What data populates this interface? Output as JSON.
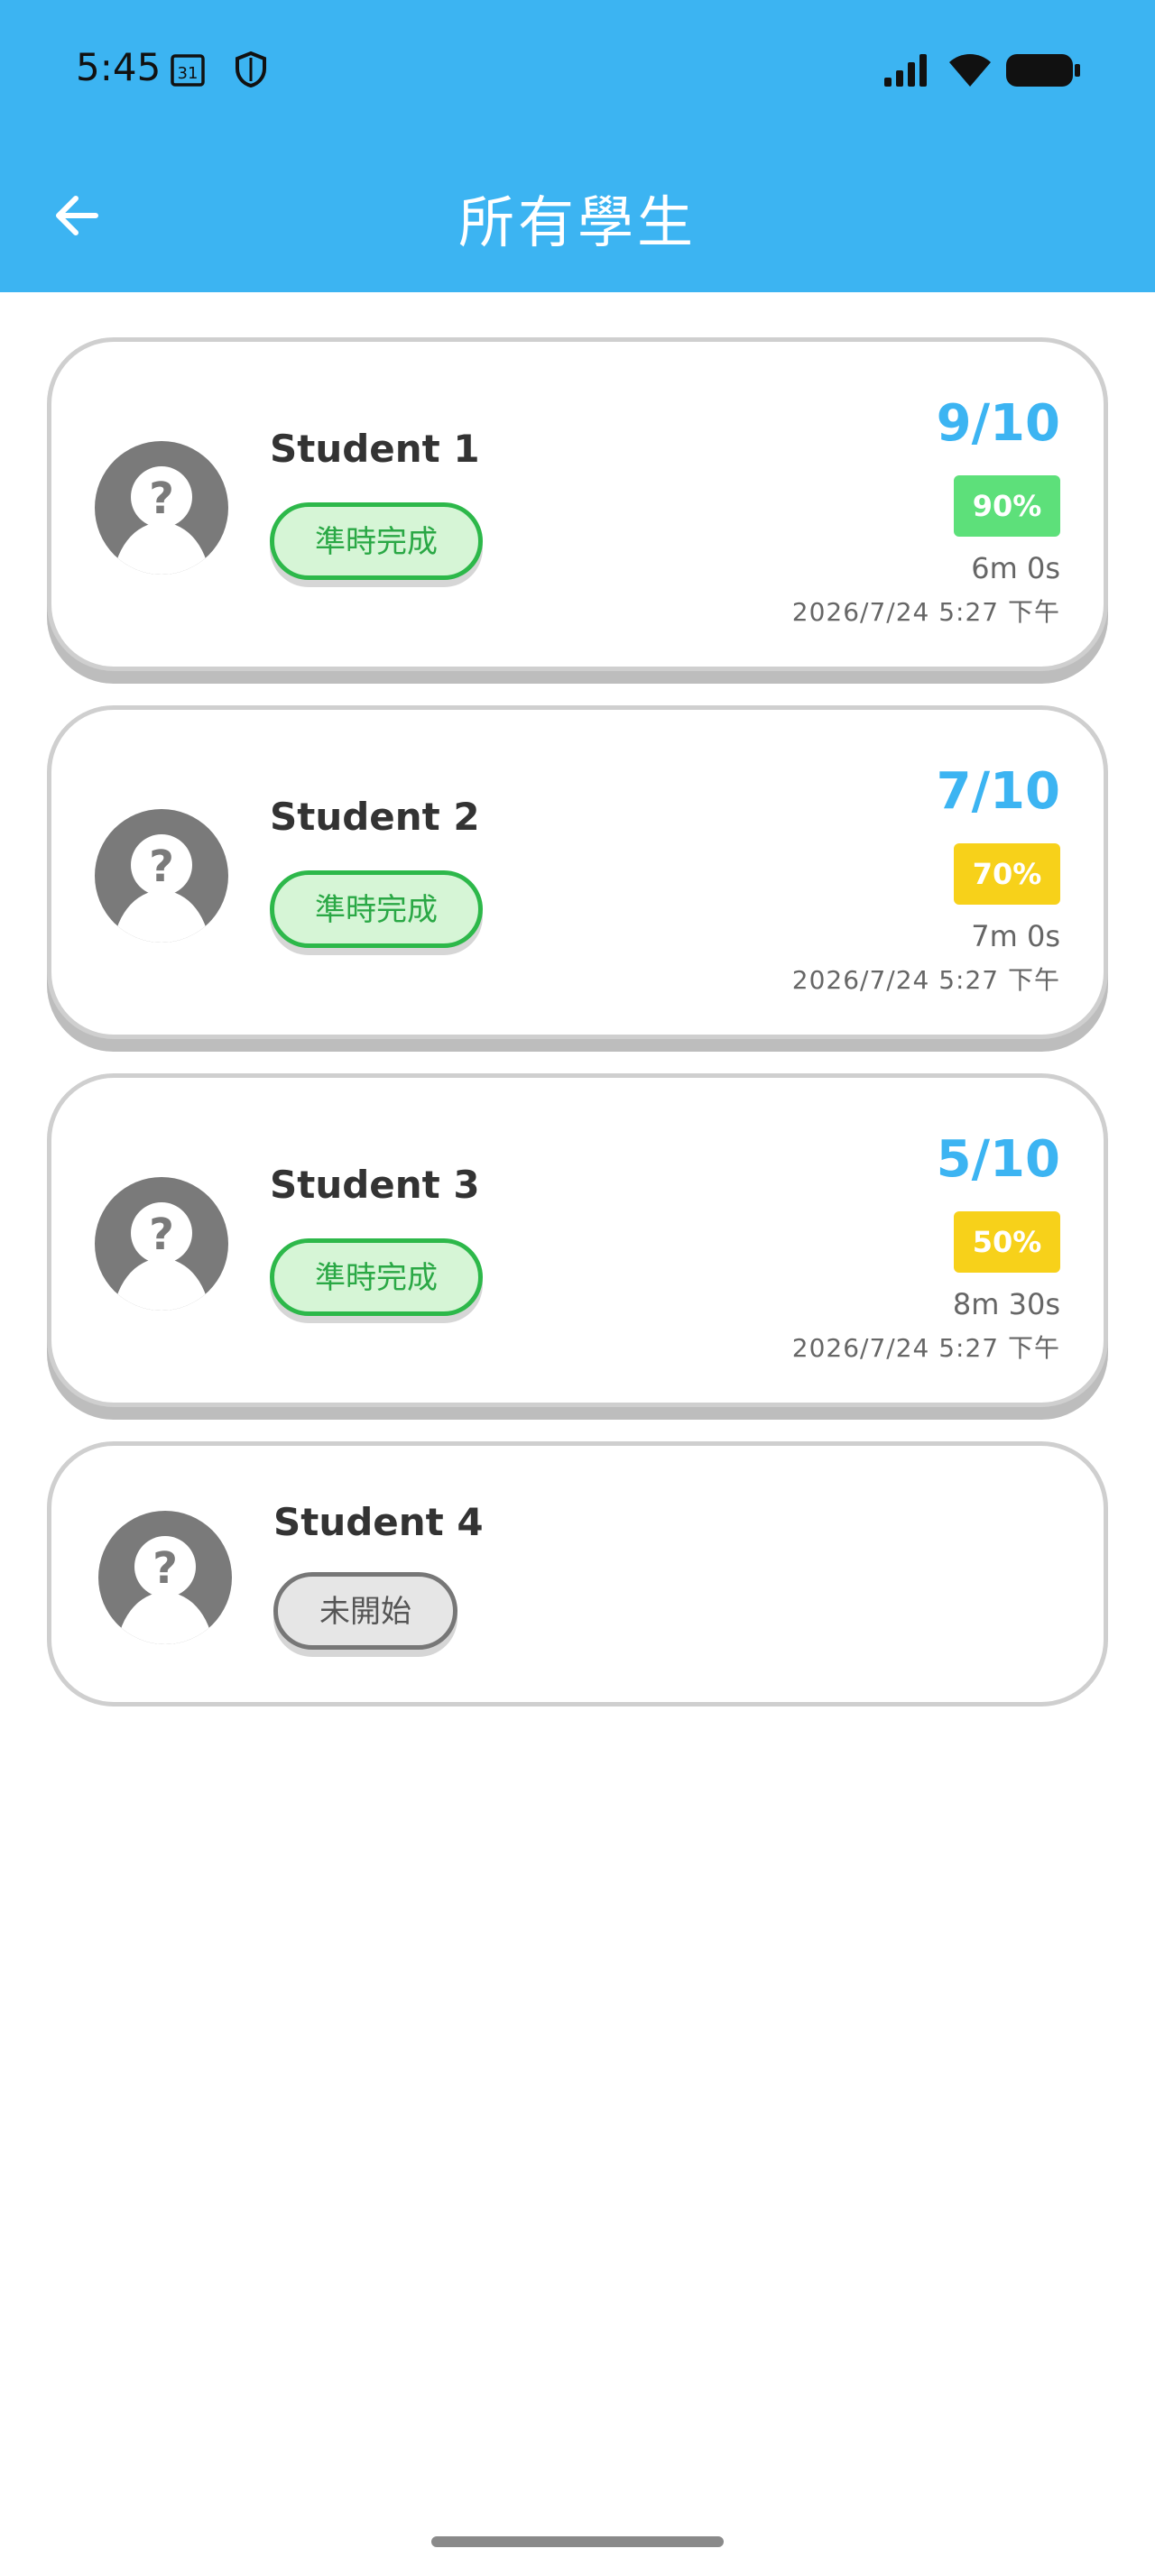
{
  "status_bar": {
    "time": "5:45",
    "calendar_day": "31"
  },
  "header": {
    "title": "所有學生",
    "background": "#3cb4f2"
  },
  "students": [
    {
      "name": "Student 1",
      "status": "準時完成",
      "score": "9/10",
      "percent": "90%",
      "percent_color": "#5de07a",
      "duration": "6m 0s",
      "datetime": "2026/7/24 5:27 下午"
    },
    {
      "name": "Student 2",
      "status": "準時完成",
      "score": "7/10",
      "percent": "70%",
      "percent_color": "#f7d11a",
      "duration": "7m 0s",
      "datetime": "2026/7/24 5:27 下午"
    },
    {
      "name": "Student 3",
      "status": "準時完成",
      "score": "5/10",
      "percent": "50%",
      "percent_color": "#f7d11a",
      "duration": "8m 30s",
      "datetime": "2026/7/24 5:27 下午"
    },
    {
      "name": "Student 4",
      "status": "未開始"
    }
  ],
  "colors": {
    "done_green": "#2db84a",
    "score_blue": "#3cb4f2"
  }
}
